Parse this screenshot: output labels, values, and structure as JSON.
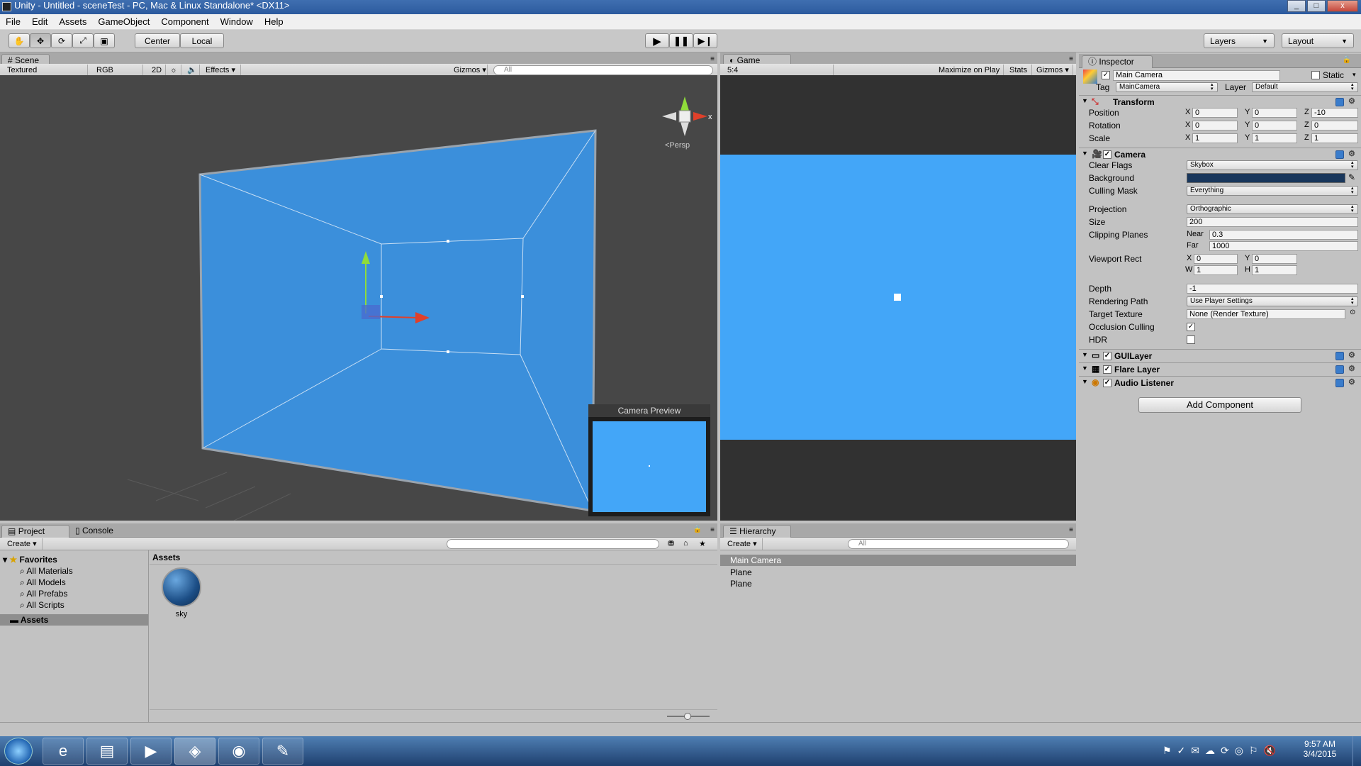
{
  "window": {
    "title": "Unity - Untitled - sceneTest - PC, Mac & Linux Standalone* <DX11>",
    "min": "_",
    "max": "□",
    "close": "x"
  },
  "menu": [
    "File",
    "Edit",
    "Assets",
    "GameObject",
    "Component",
    "Window",
    "Help"
  ],
  "toolbar": {
    "pivot": "Center",
    "space": "Local",
    "layers": "Layers",
    "layout": "Layout",
    "play_icon": "play-icon",
    "pause_icon": "pause-icon",
    "step_icon": "step-icon"
  },
  "scene": {
    "tab": "Scene",
    "shading": "Textured",
    "render_mode": "RGB",
    "mode2d": "2D",
    "effects": "Effects",
    "gizmos": "Gizmos",
    "search_placeholder": "All",
    "persp": "<Persp",
    "gizmo_x": "x",
    "camera_preview": "Camera Preview"
  },
  "game": {
    "tab": "Game",
    "aspect": "5:4",
    "maximize": "Maximize on Play",
    "stats": "Stats",
    "gizmos": "Gizmos"
  },
  "inspector": {
    "tab": "Inspector",
    "object_name": "Main Camera",
    "static": "Static",
    "tag_label": "Tag",
    "tag": "MainCamera",
    "layer_label": "Layer",
    "layer": "Default",
    "transform": {
      "title": "Transform",
      "position": {
        "label": "Position",
        "x": "0",
        "y": "0",
        "z": "-10"
      },
      "rotation": {
        "label": "Rotation",
        "x": "0",
        "y": "0",
        "z": "0"
      },
      "scale": {
        "label": "Scale",
        "x": "1",
        "y": "1",
        "z": "1"
      }
    },
    "camera": {
      "title": "Camera",
      "clear_flags_label": "Clear Flags",
      "clear_flags": "Skybox",
      "background_label": "Background",
      "background_color": "#19375c",
      "culling_label": "Culling Mask",
      "culling": "Everything",
      "projection_label": "Projection",
      "projection": "Orthographic",
      "size_label": "Size",
      "size": "200",
      "clipping_label": "Clipping Planes",
      "near_label": "Near",
      "near": "0.3",
      "far_label": "Far",
      "far": "1000",
      "viewport_label": "Viewport Rect",
      "vx": "0",
      "vy": "0",
      "vw": "1",
      "vh": "1",
      "depth_label": "Depth",
      "depth": "-1",
      "rendering_label": "Rendering Path",
      "rendering": "Use Player Settings",
      "target_label": "Target Texture",
      "target": "None (Render Texture)",
      "occlusion_label": "Occlusion Culling",
      "hdr_label": "HDR"
    },
    "components": [
      "GUILayer",
      "Flare Layer",
      "Audio Listener"
    ],
    "add_component": "Add Component"
  },
  "project": {
    "tab": "Project",
    "console_tab": "Console",
    "create": "Create",
    "favorites": "Favorites",
    "fav_items": [
      "All Materials",
      "All Models",
      "All Prefabs",
      "All Scripts"
    ],
    "assets_folder": "Assets",
    "assets_header": "Assets",
    "asset_items": [
      "sky"
    ]
  },
  "hierarchy": {
    "tab": "Hierarchy",
    "create": "Create",
    "search_placeholder": "All",
    "items": [
      "Main Camera",
      "Plane",
      "Plane"
    ]
  },
  "taskbar": {
    "time": "9:57 AM",
    "date": "3/4/2015"
  },
  "colors": {
    "scene_blue": "#3b8fdb",
    "game_blue": "#43a6f8",
    "accent": "#3f6fb0"
  }
}
